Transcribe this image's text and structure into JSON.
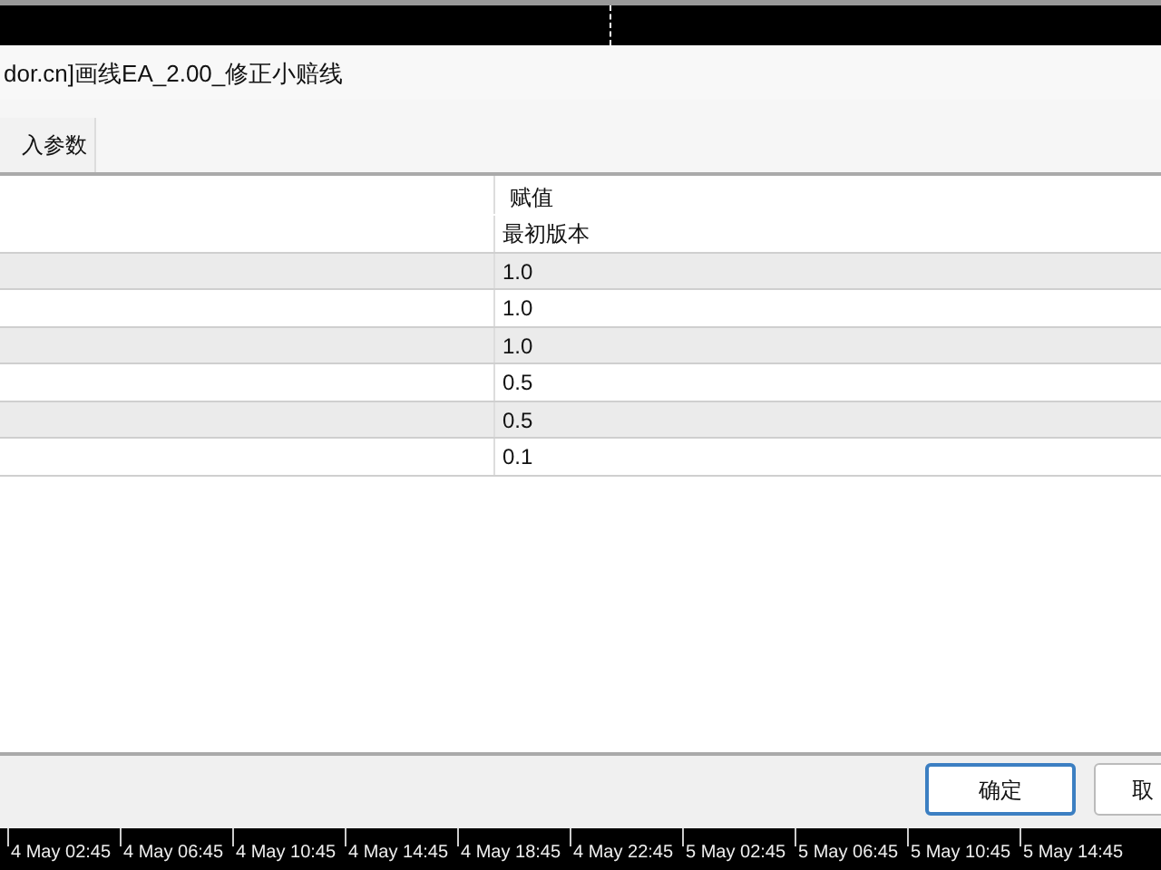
{
  "dialog": {
    "title": "dor.cn]画线EA_2.00_修正小赔线"
  },
  "tabs": [
    {
      "label": "入参数",
      "selected": true
    }
  ],
  "table": {
    "columns": [
      "赋值"
    ],
    "rows": [
      {
        "value": "最初版本"
      },
      {
        "value": "1.0"
      },
      {
        "value": "1.0"
      },
      {
        "value": "1.0"
      },
      {
        "value": "0.5"
      },
      {
        "value": "0.5"
      },
      {
        "value": "0.1"
      }
    ]
  },
  "buttons": [
    {
      "label": "确定",
      "kind": "default"
    },
    {
      "label": "取",
      "kind": "normal"
    }
  ],
  "time_axis": [
    "4 May 02:45",
    "4 May 06:45",
    "4 May 10:45",
    "4 May 14:45",
    "4 May 18:45",
    "4 May 22:45",
    "5 May 02:45",
    "5 May 06:45",
    "5 May 10:45",
    "5 May 14:45"
  ]
}
